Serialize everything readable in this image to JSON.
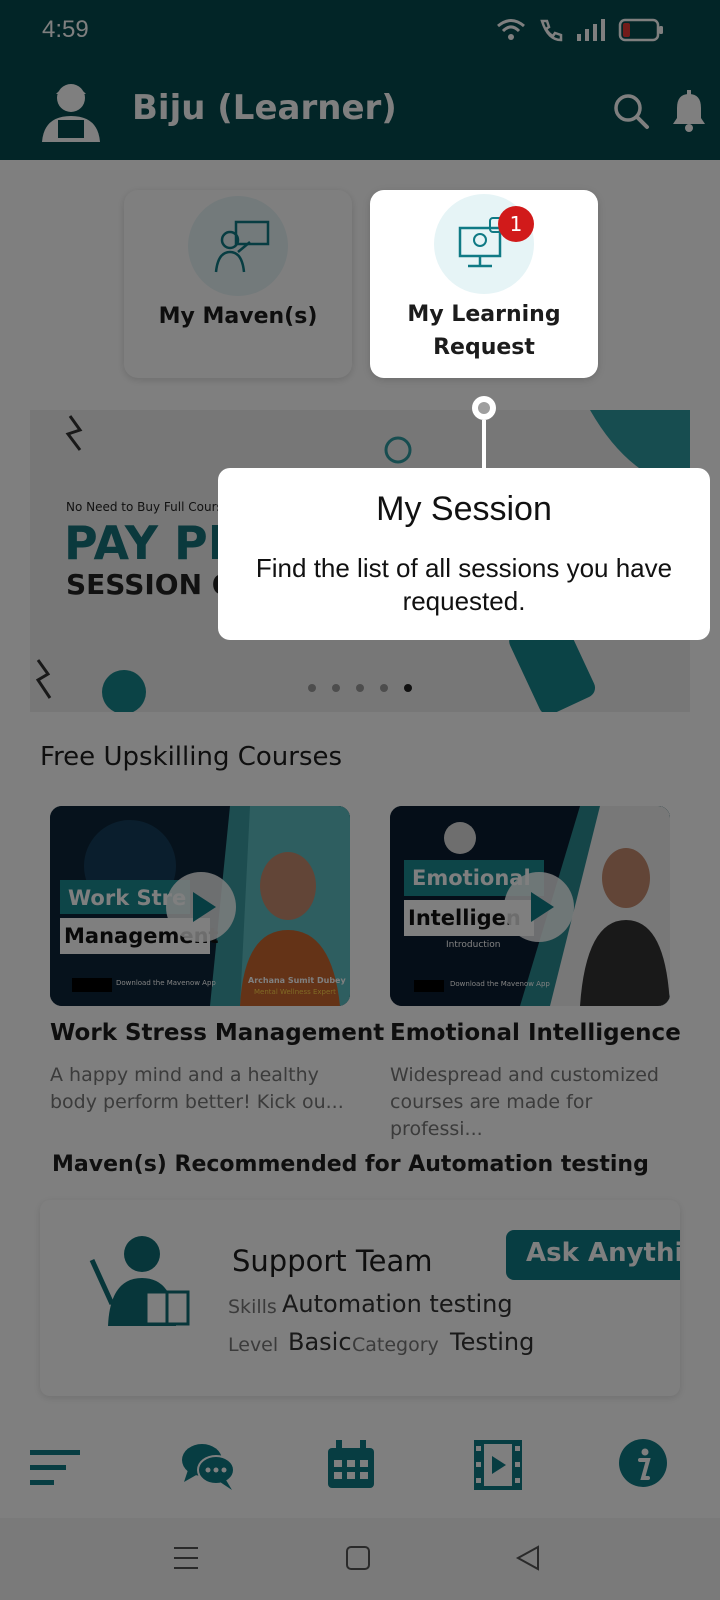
{
  "status_bar": {
    "time": "4:59"
  },
  "app_bar": {
    "title": "Biju (Learner)"
  },
  "cards": [
    {
      "label_line1": "My Maven(s)",
      "label_line2": ""
    },
    {
      "label_line1": "My Learning",
      "label_line2": "Request",
      "badge": "1"
    }
  ],
  "banner": {
    "small_text": "No Need to Buy Full Cours",
    "headline": "PAY PE",
    "subline": "SESSION ONL",
    "active_dot": 5,
    "dot_count": 5
  },
  "free_courses": {
    "title": "Free Upskilling Courses",
    "items": [
      {
        "title": "Work Stress Management",
        "desc": "A happy mind and a healthy body perform better! Kick ou...",
        "thumb_line1": "Work Stre",
        "thumb_line2": "Management",
        "presenter": "Archana Sumit Dubey",
        "presenter_role": "Mental Wellness Expert",
        "store_text": "Download the Mavenow App"
      },
      {
        "title": "Emotional Intelligence",
        "desc": "Widespread and customized courses are made for professi...",
        "thumb_line1": "Emotional",
        "thumb_line2": "Intelligen",
        "thumb_line3": "Introduction",
        "store_text": "Download the Mavenow App"
      }
    ]
  },
  "recommended": {
    "title": "Maven(s) Recommended for Automation testing",
    "maven": {
      "name": "Support Team",
      "skills_label": "Skills",
      "skills_value": "Automation testing",
      "level_label": "Level",
      "level_value": "Basic",
      "category_label": "Category",
      "category_value": "Testing",
      "ask_button": "Ask Anythin"
    }
  },
  "tooltip": {
    "title": "My Session",
    "desc": "Find the list of all sessions you have requested."
  },
  "colors": {
    "primary": "#044a4f",
    "accent": "#0f7a85",
    "badge": "#d11a1a"
  },
  "icons": [
    "user-avatar-icon",
    "search-icon",
    "bell-icon",
    "menu-icon",
    "chat-icon",
    "calendar-icon",
    "video-icon",
    "info-icon"
  ]
}
